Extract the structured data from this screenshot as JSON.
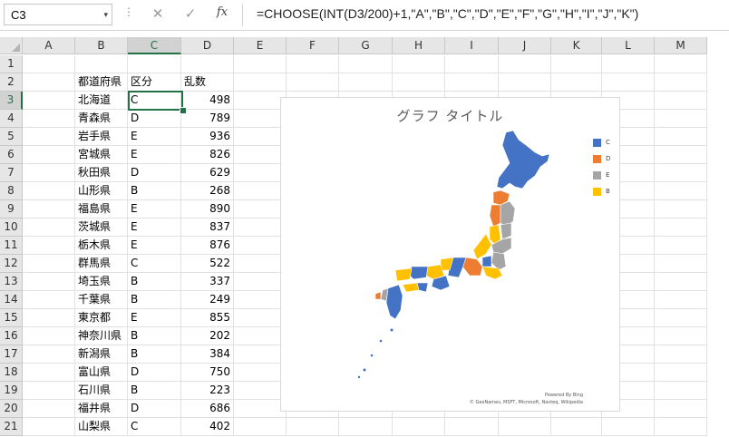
{
  "formula_bar": {
    "name_box": "C3",
    "name_box_arrow": "▾",
    "dots": "⋮",
    "cancel_icon": "✕",
    "enter_icon": "✓",
    "fx_label": "fx",
    "formula": "=CHOOSE(INT(D3/200)+1,\"A\",\"B\",\"C\",\"D\",\"E\",\"F\",\"G\",\"H\",\"I\",\"J\",\"K\")"
  },
  "columns": [
    "A",
    "B",
    "C",
    "D",
    "E",
    "F",
    "G",
    "H",
    "I",
    "J",
    "K",
    "L",
    "M"
  ],
  "selected_column": "C",
  "rows": [
    "1",
    "2",
    "3",
    "4",
    "5",
    "6",
    "7",
    "8",
    "9",
    "10",
    "11",
    "12",
    "13",
    "14",
    "15",
    "16",
    "17",
    "18",
    "19",
    "20",
    "21"
  ],
  "selected_row": "3",
  "headers": {
    "prefecture": "都道府県",
    "category": "区分",
    "random": "乱数"
  },
  "data_rows": [
    {
      "pref": "北海道",
      "cat": "C",
      "num": "498"
    },
    {
      "pref": "青森県",
      "cat": "D",
      "num": "789"
    },
    {
      "pref": "岩手県",
      "cat": "E",
      "num": "936"
    },
    {
      "pref": "宮城県",
      "cat": "E",
      "num": "826"
    },
    {
      "pref": "秋田県",
      "cat": "D",
      "num": "629"
    },
    {
      "pref": "山形県",
      "cat": "B",
      "num": "268"
    },
    {
      "pref": "福島県",
      "cat": "E",
      "num": "890"
    },
    {
      "pref": "茨城県",
      "cat": "E",
      "num": "837"
    },
    {
      "pref": "栃木県",
      "cat": "E",
      "num": "876"
    },
    {
      "pref": "群馬県",
      "cat": "C",
      "num": "522"
    },
    {
      "pref": "埼玉県",
      "cat": "B",
      "num": "337"
    },
    {
      "pref": "千葉県",
      "cat": "B",
      "num": "249"
    },
    {
      "pref": "東京都",
      "cat": "E",
      "num": "855"
    },
    {
      "pref": "神奈川県",
      "cat": "B",
      "num": "202"
    },
    {
      "pref": "新潟県",
      "cat": "B",
      "num": "384"
    },
    {
      "pref": "富山県",
      "cat": "D",
      "num": "750"
    },
    {
      "pref": "石川県",
      "cat": "B",
      "num": "223"
    },
    {
      "pref": "福井県",
      "cat": "D",
      "num": "686"
    },
    {
      "pref": "山梨県",
      "cat": "C",
      "num": "402"
    }
  ],
  "chart": {
    "title": "グラフ タイトル",
    "legend": [
      {
        "label": "C",
        "color": "#4472c4"
      },
      {
        "label": "D",
        "color": "#ed7d31"
      },
      {
        "label": "E",
        "color": "#a5a5a5"
      },
      {
        "label": "B",
        "color": "#ffc000"
      }
    ],
    "credit_line1": "Powered By Bing",
    "credit_line2": "© GeoNames, MSFT, Microsoft, Navteq, Wikipedia"
  },
  "colors": {
    "selection": "#217346",
    "C": "#4472c4",
    "D": "#ed7d31",
    "E": "#a5a5a5",
    "B": "#ffc000"
  }
}
